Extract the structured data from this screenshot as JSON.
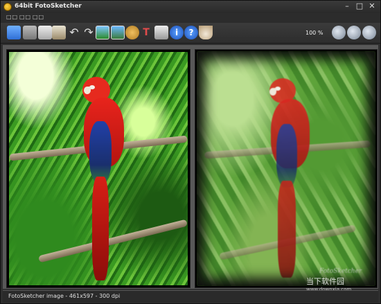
{
  "window": {
    "title": "64bit FotoSketcher"
  },
  "menu": {
    "items": [
      "□□",
      "□□",
      "□□"
    ]
  },
  "toolbar": {
    "zoom": "100 %"
  },
  "signature": "FotoSketcher",
  "watermark": {
    "main": "当下软件园",
    "sub": "www.downxia.com"
  },
  "status": {
    "text": "FotoSketcher image - 461x597 - 300 dpi"
  },
  "colors": {
    "accent": "#2f6fd6",
    "panel_bg": "#585858",
    "toolbar_bg": "#333333"
  },
  "icons": [
    "open-folder-icon",
    "save-icon",
    "copy-icon",
    "paste-icon",
    "undo-icon",
    "redo-icon",
    "image-before-icon",
    "image-after-icon",
    "paint-palette-icon",
    "text-icon",
    "print-icon",
    "info-icon",
    "help-icon",
    "coffee-cup-icon",
    "zoom-in-icon",
    "zoom-fit-icon",
    "zoom-out-icon"
  ]
}
